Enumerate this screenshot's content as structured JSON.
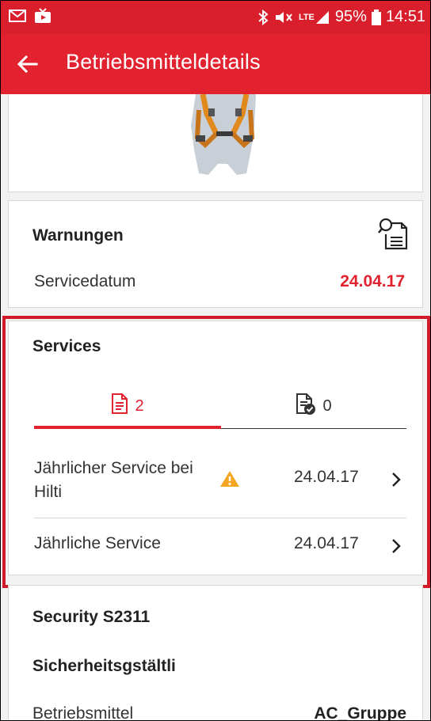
{
  "status_bar": {
    "battery": "95%",
    "time": "14:51",
    "network": "LTE"
  },
  "app_bar": {
    "title": "Betriebsmitteldetails"
  },
  "warnings": {
    "title": "Warnungen",
    "row_label": "Servicedatum",
    "row_value": "24.04.17",
    "value_color": "#e2232f"
  },
  "services": {
    "title": "Services",
    "tabs": [
      {
        "count": "2",
        "icon": "document-icon",
        "active": true
      },
      {
        "count": "0",
        "icon": "document-check-icon",
        "active": false
      }
    ],
    "items": [
      {
        "label": "Jährlicher Service bei Hilti",
        "date": "24.04.17",
        "warning": true
      },
      {
        "label": "Jährliche Service",
        "date": "24.04.17",
        "warning": false
      }
    ]
  },
  "equipment": {
    "name": "Security S2311",
    "category": "Sicherheitsgstältli",
    "row_label": "Betriebsmittel",
    "row_value": "AC_Gruppe"
  },
  "colors": {
    "accent": "#e2232f",
    "warning": "#f5a623"
  }
}
